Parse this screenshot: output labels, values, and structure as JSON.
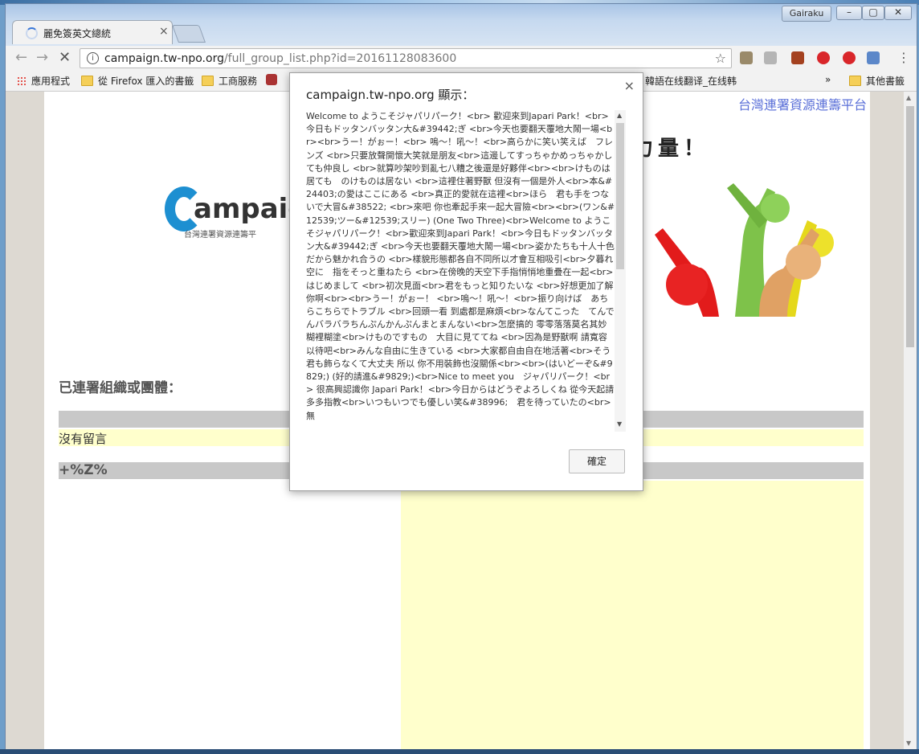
{
  "window": {
    "user_badge": "Gairaku",
    "tab_title": "麗免簽英文總統",
    "colors": {
      "accent": "#3a78d8",
      "link": "#5a6fd8",
      "logo_blue": "#1d8fd1",
      "highlight_row": "#ffffcc"
    }
  },
  "toolbar": {
    "url_host": "campaign.tw-npo.org",
    "url_path": "/full_group_list.php?id=20161128083600"
  },
  "bookmarks": {
    "apps": "應用程式",
    "firefox": "從 Firefox 匯入的書籤",
    "business": "工商服務",
    "translate": "韓語在线翻译_在线韩",
    "more": "»",
    "other": "其他書籤"
  },
  "page": {
    "platform_link": "台灣連署資源連籌平台",
    "logo_text": "ampaign",
    "logo_sub": "台灣連署資源連籌平",
    "headline": "力量！",
    "section_title": "已連署組織或團體：",
    "no_comment": "沒有留言",
    "sub_header": "+%Z%"
  },
  "dialog": {
    "title": "campaign.tw-npo.org 顯示：",
    "close": "×",
    "message": "Welcome to ようこそジャパリパーク！<br> 歡迎來到Japari Park！<br>今日もドッタンバッタン大&#39442;ぎ <br>今天也要翻天覆地大鬧一場<br><br>うー！がぉー！<br> 嗚～！吼～！<br>高らかに笑い笑えば　フレンズ <br>只要放聲開懷大笑就是朋友<br>這邊してすっちゃかめっちゃかしても仲良し <br>就算吵架吵到亂七八糟之後還是好夥伴<br><br>けものは居ても　のけものは居ない <br>這裡住著野獸 但沒有一個是外人<br>本&#24403;の愛はここにある <br>真正的愛就在這裡<br>ほら　君も手をつないで大冒&#38522; <br>來吧 你也牽起手來一起大冒險<br><br>(ワン&#12539;ツー&#12539;スリー) (One Two Three)<br>Welcome to ようこそジャパリパーク！<br>歡迎來到Japari Park！<br>今日もドッタンバッタン大&#39442;ぎ <br>今天也要翻天覆地大鬧一場<br>姿かたちも十人十色　だから魅かれ合うの <br>樣貌形態都各自不同所以才會互相吸引<br>夕暮れ空に　指をそっと重ねたら <br>在傍晚的天空下手指悄悄地重疊在一起<br>はじめまして <br>初次見面<br>君をもっと知りたいな <br>好想更加了解你啊<br><br>うー！がぉー！ <br>嗚～！吼～！<br>振り向けば　あちらこちらでトラブル <br>回頭一看 到處都是麻煩<br>なんてこった　てんでんバラバラちんぷんかんぷんまとまんない<br>怎麼搞的 零零落落莫名其妙糊裡糊塗<br>けものですもの　大目に見ててね <br>因為是野獸啊 請寬容以待吧<br>みんな自由に生きている <br>大家都自由自在地活著<br>そう　君も飾らなくて大丈夫 所以 你不用裝飾也沒關係<br><br>(はいどーぞ&#9829;) (好的請進&#9829;)<br>Nice to meet you　ジャパリパーク！<br> 很高興認識你 Japari Park！<br>今日からはどうぞよろしくね 從今天起請多多指教<br>いつもいつでも優しい笑&#38996;　君を待っていたの<br> 無",
    "ok_label": "確定"
  }
}
